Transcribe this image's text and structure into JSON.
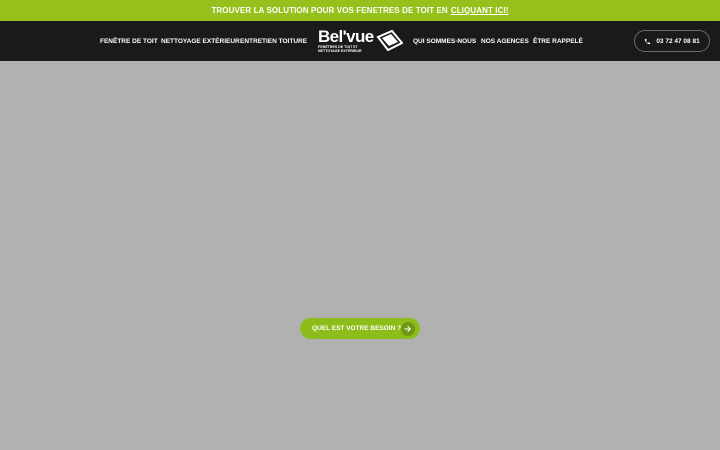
{
  "announcement": {
    "text": "TROUVER LA SOLUTION POUR VOS FENETRES DE TOIT EN",
    "link_label": "CLIQUANT ICI!"
  },
  "nav": {
    "left": [
      {
        "label": "FENÊTRE DE TOIT"
      },
      {
        "label": "NETTOYAGE EXTÉRIEUR"
      },
      {
        "label": "ENTRETIEN TOITURE"
      }
    ],
    "right": [
      {
        "label": "QUI SOMMES-NOUS"
      },
      {
        "label": "NOS AGENCES"
      },
      {
        "label": "ÊTRE RAPPELÉ"
      }
    ]
  },
  "logo": {
    "brand": "Bel'vue",
    "tagline_line1": "FENÊTRES DE TOIT ET",
    "tagline_line2": "NETTOYAGE EXTÉRIEUR"
  },
  "phone": {
    "number": "03 72 47 08 81",
    "icon": "phone-icon"
  },
  "hero": {
    "cta_label": "QUEL EST VOTRE BESOIN ?",
    "cta_icon": "arrow-right-icon"
  },
  "colors": {
    "accent_green": "#96c01c",
    "header_bg": "#1a1a1a",
    "hero_bg": "#b1b1b1"
  }
}
